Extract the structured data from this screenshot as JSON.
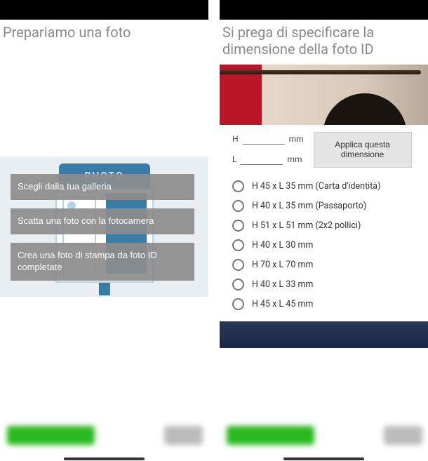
{
  "left": {
    "title": "Prepariamo una foto",
    "booth_label": "PHOTO",
    "options": [
      "Scegli dalla tua galleria",
      "Scatta una foto con la fotocamera",
      "Crea una foto di stampa da foto ID completate"
    ]
  },
  "right": {
    "title": "Si prega di specificare la dimensione della foto ID",
    "fields": {
      "h_label": "H",
      "l_label": "L",
      "unit": "mm"
    },
    "apply_label": "Applica questa dimensione",
    "sizes": [
      "H 45 x L 35 mm (Carta d'identità)",
      "H 40 x L 35 mm (Passaporto)",
      "H 51 x L 51 mm (2x2 pollici)",
      "H 40 x L 30 mm",
      "H 70 x L 70 mm",
      "H 40 x L 33 mm",
      "H 45 x L 45 mm"
    ]
  }
}
